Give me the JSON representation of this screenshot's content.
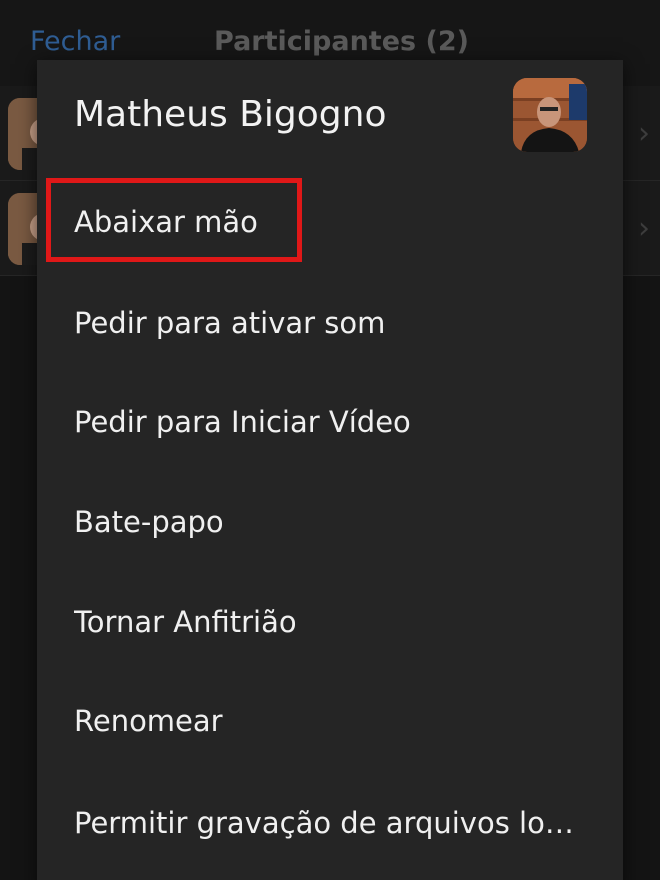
{
  "background": {
    "close_label": "Fechar",
    "title": "Participantes (2)",
    "rows": [
      {
        "chevron": "›"
      },
      {
        "chevron": "›"
      }
    ]
  },
  "sheet": {
    "participant_name": "Matheus Bigogno",
    "items": [
      {
        "label": "Abaixar mão",
        "highlighted": true
      },
      {
        "label": "Pedir para ativar som"
      },
      {
        "label": "Pedir para Iniciar Vídeo"
      },
      {
        "label": "Bate-papo"
      },
      {
        "label": "Tornar Anfitrião"
      },
      {
        "label": "Renomear"
      },
      {
        "label": "Permitir gravação de arquivos lo…"
      }
    ]
  },
  "colors": {
    "highlight": "#e01818",
    "close_link": "#2f5d93",
    "sheet_bg": "#252525"
  }
}
